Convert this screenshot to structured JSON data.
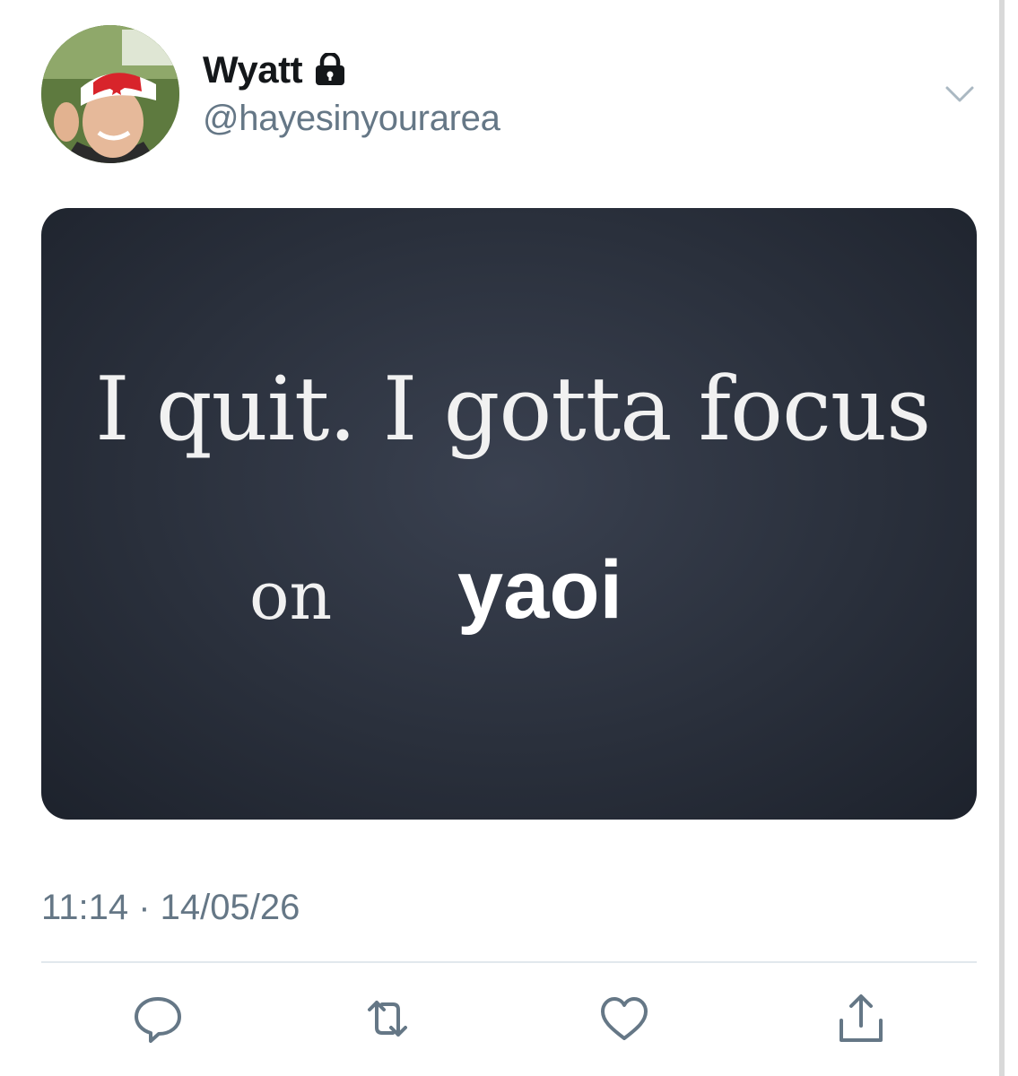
{
  "tweet": {
    "display_name": "Wyatt",
    "handle": "@hayesinyourarea",
    "protected_icon": "lock-icon",
    "menu_icon": "chevron-down-icon",
    "media": {
      "line1": "I quit. I gotta focus",
      "line2_prefix": "on",
      "line2_emphasis": "yaoi"
    },
    "timestamp": "11:14 · 14/05/26",
    "actions": [
      {
        "icon": "reply-icon"
      },
      {
        "icon": "retweet-icon"
      },
      {
        "icon": "like-icon"
      },
      {
        "icon": "share-icon"
      }
    ]
  },
  "colors": {
    "text_primary": "#14171a",
    "text_secondary": "#657786",
    "divider": "#e1e8ed",
    "media_background": "#2a303c"
  }
}
